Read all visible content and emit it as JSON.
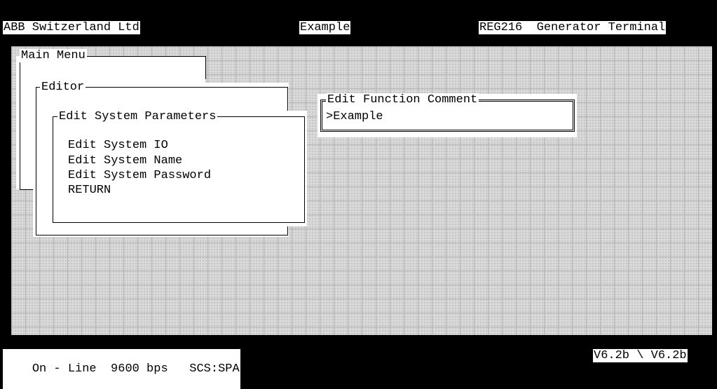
{
  "header": {
    "company": "ABB Switzerland Ltd",
    "project": "Example",
    "device": "REG216  Generator Terminal"
  },
  "windows": {
    "main_menu": {
      "title": "Main Menu"
    },
    "editor": {
      "title": "Editor"
    },
    "edit_system_parameters": {
      "title": "Edit System Parameters",
      "items": [
        "Edit System IO",
        "Edit System Name",
        "Edit System Password",
        "RETURN"
      ]
    },
    "edit_function_comment": {
      "title": "Edit Function Comment",
      "value": ">Example"
    }
  },
  "status": {
    "connection": "On - Line",
    "baud": "9600 bps",
    "protocol": "SCS:SPA",
    "version": "V6.2b \\ V6.2b"
  }
}
